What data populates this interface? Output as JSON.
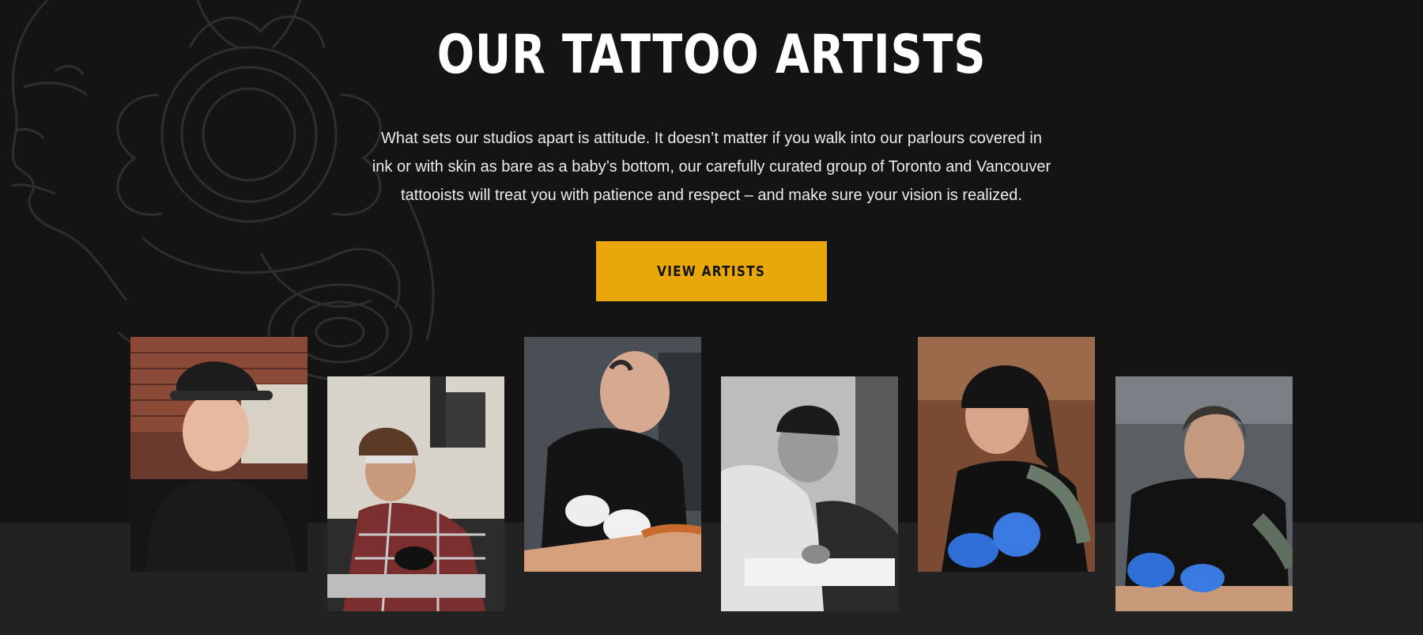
{
  "section": {
    "title": "OUR TATTOO ARTISTS",
    "intro_line1": "What sets our studios apart is attitude. It doesn’t matter if you walk into our parlours covered in",
    "intro_line2": "ink or with skin as bare as a baby’s bottom, our carefully curated group of Toronto and Vancouver",
    "intro_line3": "tattooists will treat you with patience and respect – and make sure your vision is realized.",
    "cta_label": "VIEW ARTISTS"
  },
  "colors": {
    "background": "#141414",
    "band": "#222222",
    "accent": "#e8a80c"
  },
  "decoration": {
    "icon": "tattoo-woman-lineart-icon"
  },
  "artists": [
    {
      "photo": "artist-photo-smiling-cap"
    },
    {
      "photo": "artist-photo-plaid-shirt-tattooing"
    },
    {
      "photo": "artist-photo-bald-head-tattoo"
    },
    {
      "photo": "artist-photo-black-white-beanie"
    },
    {
      "photo": "artist-photo-woman-blue-gloves"
    },
    {
      "photo": "artist-photo-slicked-hair-tattooing"
    }
  ]
}
